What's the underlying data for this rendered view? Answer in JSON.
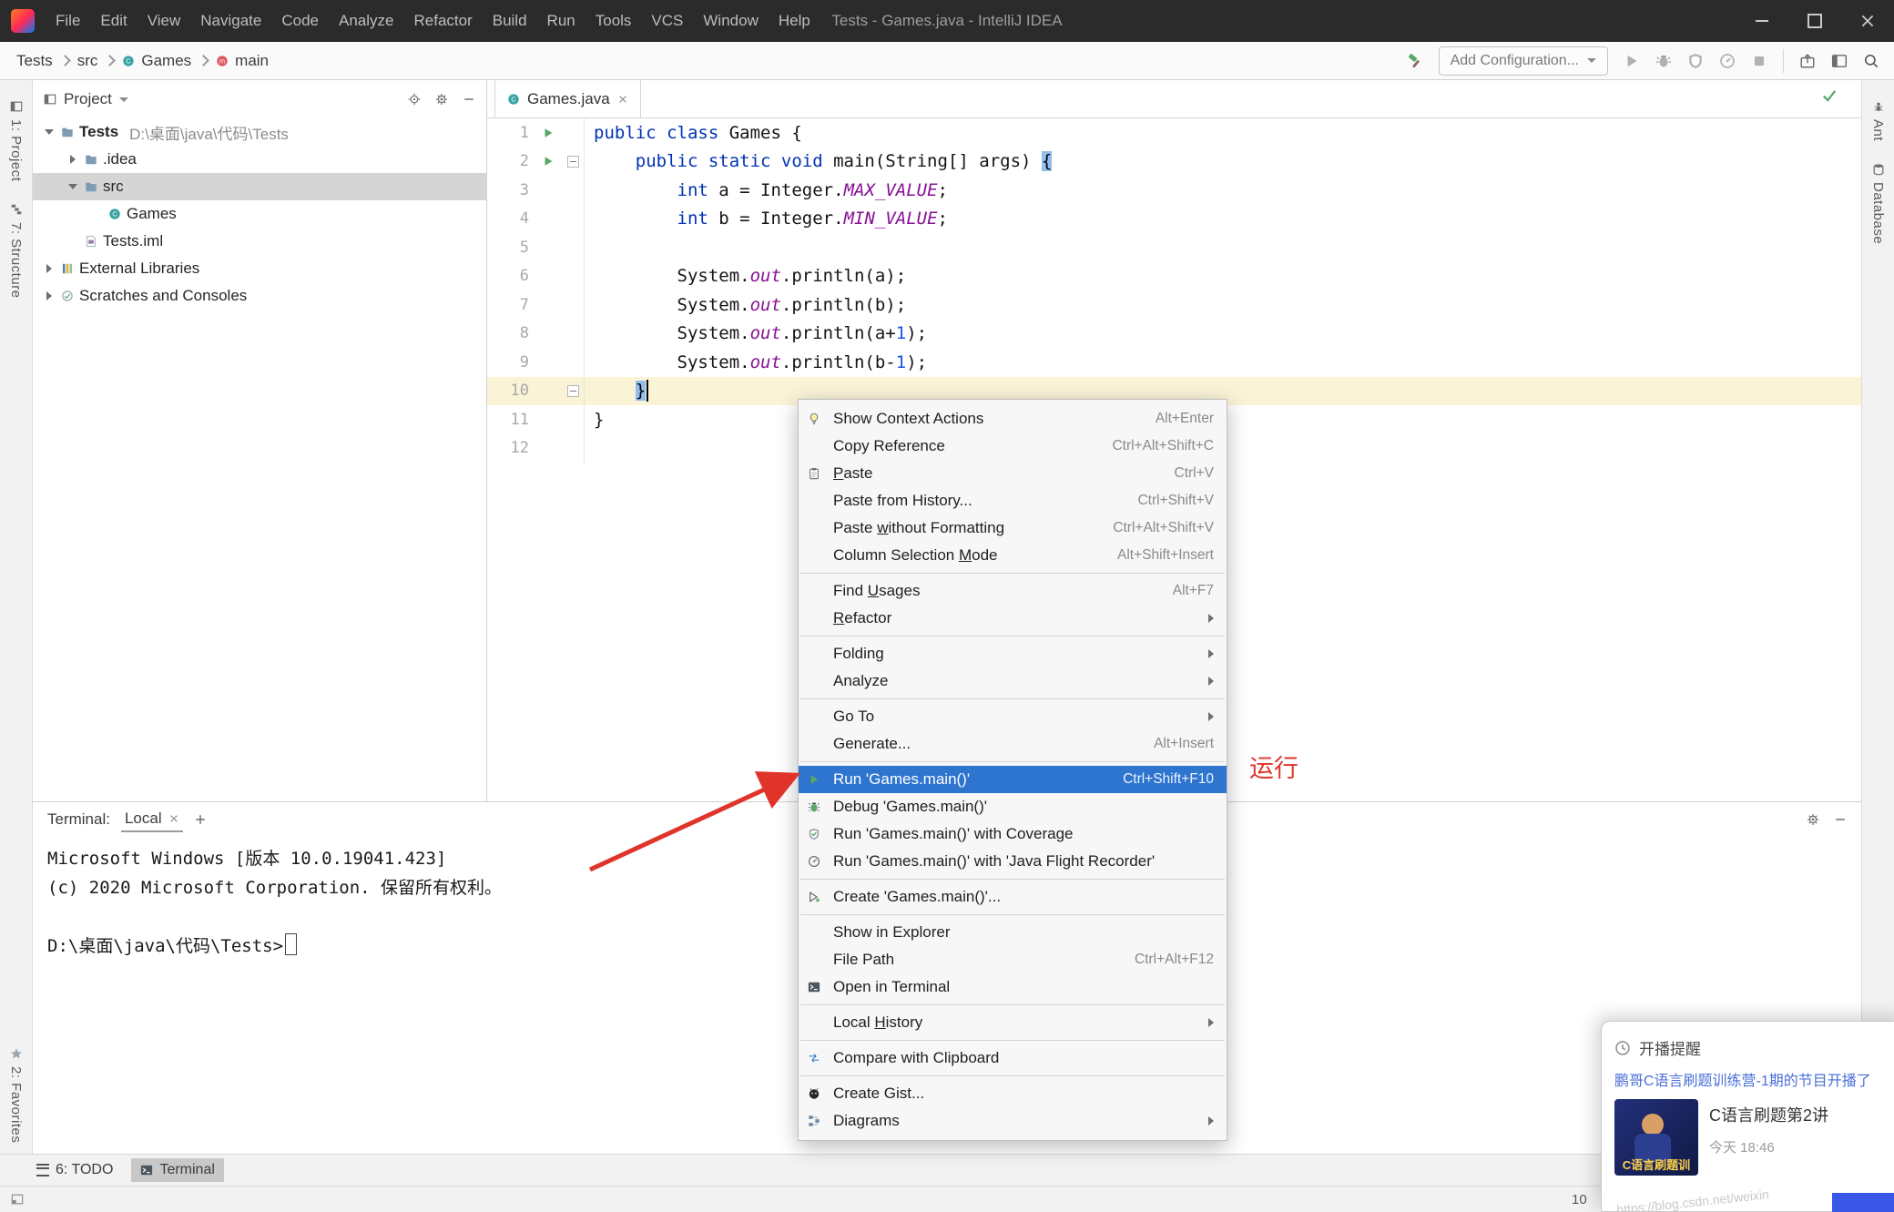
{
  "window": {
    "title": "Tests - Games.java - IntelliJ IDEA"
  },
  "menubar": [
    "File",
    "Edit",
    "View",
    "Navigate",
    "Code",
    "Analyze",
    "Refactor",
    "Build",
    "Run",
    "Tools",
    "VCS",
    "Window",
    "Help"
  ],
  "navbar": {
    "breadcrumbs": [
      {
        "label": "Tests"
      },
      {
        "label": "src"
      },
      {
        "label": "Games",
        "icon": "class"
      },
      {
        "label": "main",
        "icon": "method"
      }
    ],
    "add_configuration": "Add Configuration..."
  },
  "stripes": {
    "left_top": [
      {
        "label": "1: Project",
        "icon": "stripeProject"
      },
      {
        "label": "7: Structure",
        "icon": "stripeStructure"
      }
    ],
    "left_bottom": [
      {
        "label": "2: Favorites",
        "icon": "star"
      }
    ],
    "right": [
      {
        "label": "Ant",
        "icon": "stripeAnt"
      },
      {
        "label": "Database",
        "icon": "stripeDb"
      }
    ]
  },
  "project": {
    "title": "Project",
    "tree": [
      {
        "label": "Tests",
        "path": "D:\\桌面\\java\\代码\\Tests",
        "icon": "folder",
        "level": 0,
        "state": "expanded",
        "bold": true
      },
      {
        "label": ".idea",
        "icon": "folder",
        "level": 1,
        "state": "collapsed"
      },
      {
        "label": "src",
        "icon": "folder",
        "level": 1,
        "state": "expanded",
        "selected": true
      },
      {
        "label": "Games",
        "icon": "class",
        "level": 2,
        "state": "leaf"
      },
      {
        "label": "Tests.iml",
        "icon": "iml",
        "level": 1,
        "state": "leaf"
      },
      {
        "label": "External Libraries",
        "icon": "libs",
        "level": 0,
        "state": "collapsed"
      },
      {
        "label": "Scratches and Consoles",
        "icon": "scratch",
        "level": 0,
        "state": "collapsed"
      }
    ]
  },
  "editor": {
    "tab": "Games.java",
    "current_line": 10,
    "caret_line": 10,
    "lines": [
      {
        "n": 1,
        "run": true,
        "tokens": [
          [
            "k",
            "public class "
          ],
          [
            "p",
            "Games {"
          ]
        ]
      },
      {
        "n": 2,
        "run": true,
        "fold": true,
        "tokens": [
          [
            "p",
            "    "
          ],
          [
            "k",
            "public static void "
          ],
          [
            "p",
            "main(String[] args) "
          ],
          [
            "b",
            "{"
          ]
        ]
      },
      {
        "n": 3,
        "tokens": [
          [
            "p",
            "        "
          ],
          [
            "k",
            "int "
          ],
          [
            "p",
            "a = Integer."
          ],
          [
            "f",
            "MAX_VALUE"
          ],
          [
            "p",
            ";"
          ]
        ]
      },
      {
        "n": 4,
        "tokens": [
          [
            "p",
            "        "
          ],
          [
            "k",
            "int "
          ],
          [
            "p",
            "b = Integer."
          ],
          [
            "f",
            "MIN_VALUE"
          ],
          [
            "p",
            ";"
          ]
        ]
      },
      {
        "n": 5,
        "tokens": []
      },
      {
        "n": 6,
        "tokens": [
          [
            "p",
            "        System."
          ],
          [
            "f",
            "out"
          ],
          [
            "p",
            ".println(a);"
          ]
        ]
      },
      {
        "n": 7,
        "tokens": [
          [
            "p",
            "        System."
          ],
          [
            "f",
            "out"
          ],
          [
            "p",
            ".println(b);"
          ]
        ]
      },
      {
        "n": 8,
        "tokens": [
          [
            "p",
            "        System."
          ],
          [
            "f",
            "out"
          ],
          [
            "p",
            ".println(a+"
          ],
          [
            "d",
            "1"
          ],
          [
            "p",
            ");"
          ]
        ]
      },
      {
        "n": 9,
        "tokens": [
          [
            "p",
            "        System."
          ],
          [
            "f",
            "out"
          ],
          [
            "p",
            ".println(b-"
          ],
          [
            "d",
            "1"
          ],
          [
            "p",
            ");"
          ]
        ]
      },
      {
        "n": 10,
        "fold": true,
        "tokens": [
          [
            "p",
            "    "
          ],
          [
            "b",
            "}"
          ]
        ]
      },
      {
        "n": 11,
        "tokens": [
          [
            "p",
            "}"
          ]
        ]
      },
      {
        "n": 12,
        "tokens": []
      }
    ]
  },
  "context_menu": {
    "items": [
      {
        "label": "Show Context Actions",
        "shortcut": "Alt+Enter",
        "icon": "lightbulb"
      },
      {
        "label": "Copy Reference",
        "shortcut": "Ctrl+Alt+Shift+C"
      },
      {
        "label": "Paste",
        "shortcut": "Ctrl+V",
        "icon": "paste",
        "mn": "P"
      },
      {
        "label": "Paste from History...",
        "shortcut": "Ctrl+Shift+V"
      },
      {
        "label": "Paste without Formatting",
        "shortcut": "Ctrl+Alt+Shift+V",
        "mn": "w"
      },
      {
        "label": "Column Selection Mode",
        "shortcut": "Alt+Shift+Insert",
        "mn": "M",
        "sep": true
      },
      {
        "label": "Find Usages",
        "shortcut": "Alt+F7",
        "mn": "U"
      },
      {
        "label": "Refactor",
        "submenu": true,
        "mn": "R",
        "sep": true
      },
      {
        "label": "Folding",
        "submenu": true
      },
      {
        "label": "Analyze",
        "submenu": true,
        "sep": true
      },
      {
        "label": "Go To",
        "submenu": true
      },
      {
        "label": "Generate...",
        "shortcut": "Alt+Insert",
        "sep": true
      },
      {
        "label": "Run 'Games.main()'",
        "shortcut": "Ctrl+Shift+F10",
        "icon": "run",
        "highlight": true
      },
      {
        "label": "Debug 'Games.main()'",
        "icon": "debug"
      },
      {
        "label": "Run 'Games.main()' with Coverage",
        "icon": "coverage"
      },
      {
        "label": "Run 'Games.main()' with 'Java Flight Recorder'",
        "icon": "profiler",
        "sep": true
      },
      {
        "label": "Create 'Games.main()'...",
        "icon": "createRun",
        "sep": true
      },
      {
        "label": "Show in Explorer"
      },
      {
        "label": "File Path",
        "shortcut": "Ctrl+Alt+F12"
      },
      {
        "label": "Open in Terminal",
        "icon": "terminal",
        "sep": true
      },
      {
        "label": "Local History",
        "submenu": true,
        "mn": "H",
        "sep": true
      },
      {
        "label": "Compare with Clipboard",
        "icon": "diff",
        "sep": true
      },
      {
        "label": "Create Gist...",
        "icon": "github"
      },
      {
        "label": "Diagrams",
        "submenu": true,
        "icon": "diagram"
      }
    ]
  },
  "annotation": {
    "run_label": "运行"
  },
  "terminal": {
    "title": "Terminal:",
    "tab": "Local",
    "lines": [
      "Microsoft Windows [版本 10.0.19041.423]",
      "(c) 2020 Microsoft Corporation. 保留所有权利。",
      "",
      "D:\\桌面\\java\\代码\\Tests>"
    ]
  },
  "bottom": {
    "todo": "6: TODO",
    "terminal": "Terminal",
    "status_right": "10"
  },
  "notification": {
    "title": "开播提醒",
    "link": "鹏哥C语言刷题训练营-1期的节目开播了",
    "video_title": "C语言刷题第2讲",
    "video_time": "今天 18:46",
    "thumb_caption": "C语言刷题训",
    "watermark": "https://blog.csdn.net/weixin"
  },
  "colors": {
    "menu_highlight": "#2E75CF",
    "annotation_red": "#E0342B",
    "keyword": "#0033B3",
    "static_field": "#871094",
    "number": "#1750EB",
    "run_green": "#59A869"
  }
}
